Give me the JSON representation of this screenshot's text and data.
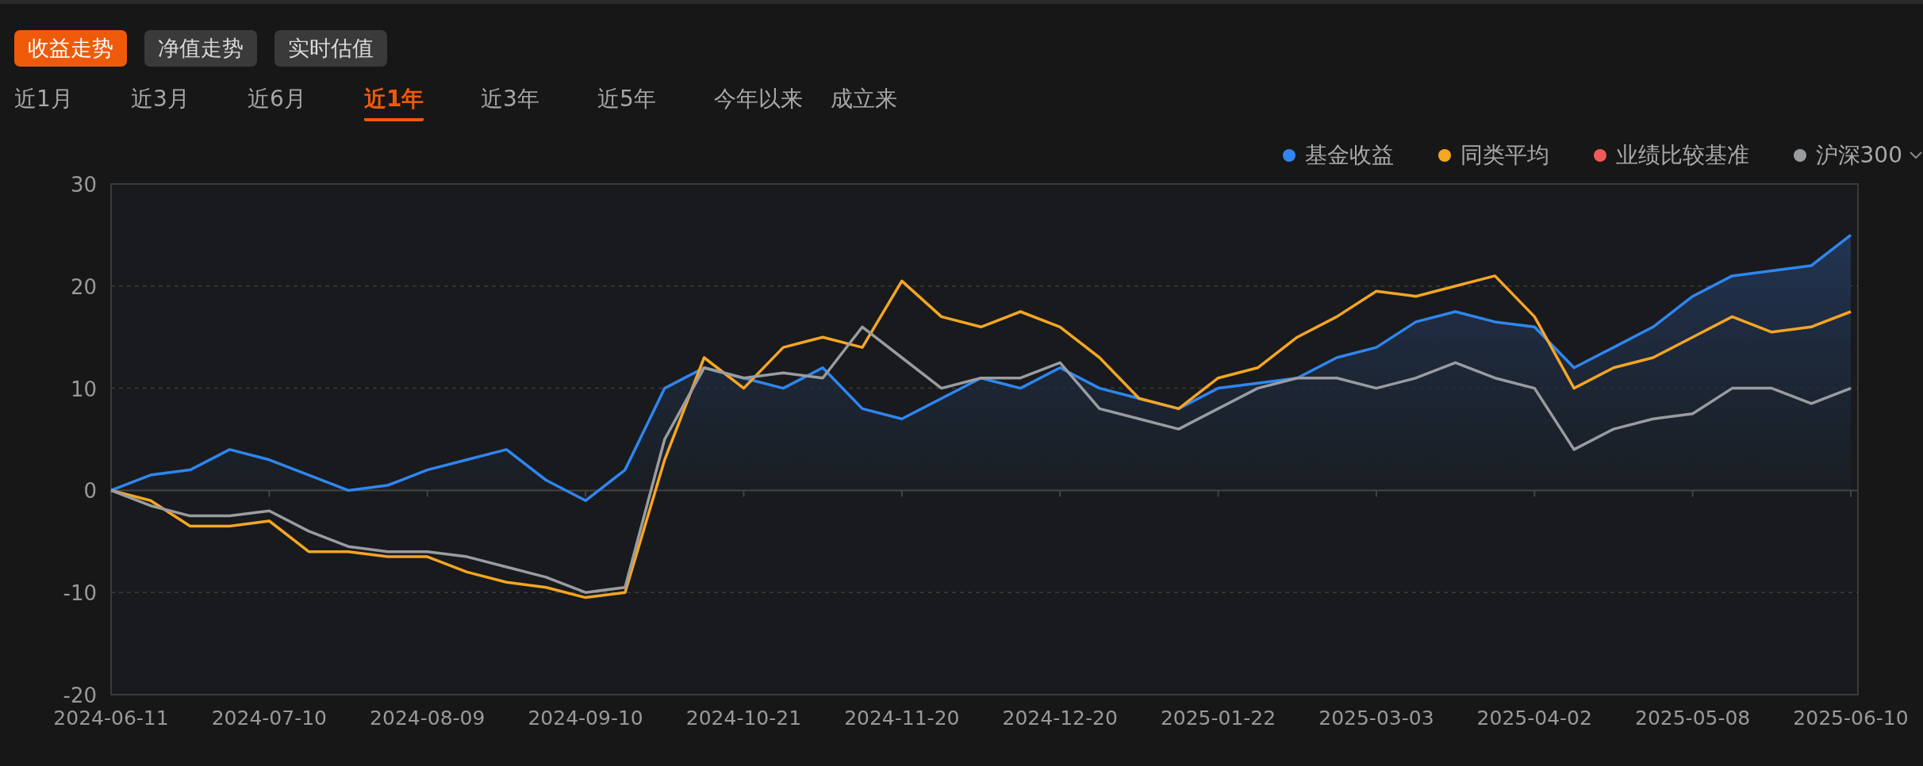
{
  "view_tabs": [
    {
      "label": "收益走势",
      "selected": true
    },
    {
      "label": "净值走势",
      "selected": false
    },
    {
      "label": "实时估值",
      "selected": false
    }
  ],
  "period_tabs": [
    {
      "label": "近1月",
      "selected": false
    },
    {
      "label": "近3月",
      "selected": false
    },
    {
      "label": "近6月",
      "selected": false
    },
    {
      "label": "近1年",
      "selected": true
    },
    {
      "label": "近3年",
      "selected": false
    },
    {
      "label": "近5年",
      "selected": false
    },
    {
      "label": "今年以来",
      "selected": false
    },
    {
      "label": "成立来",
      "selected": false
    }
  ],
  "chart_data": {
    "type": "line",
    "categories": [
      "2024-06-11",
      null,
      null,
      null,
      "2024-07-10",
      null,
      null,
      null,
      "2024-08-09",
      null,
      null,
      null,
      "2024-09-10",
      null,
      null,
      null,
      "2024-10-21",
      null,
      null,
      null,
      "2024-11-20",
      null,
      null,
      null,
      "2024-12-20",
      null,
      null,
      null,
      "2025-01-22",
      null,
      null,
      null,
      "2025-03-03",
      null,
      null,
      null,
      "2025-04-02",
      null,
      null,
      null,
      "2025-05-08",
      null,
      null,
      null,
      "2025-06-10"
    ],
    "yticks": [
      -20,
      -10,
      0,
      10,
      20,
      30
    ],
    "ylim": [
      -20,
      30
    ],
    "grid": true,
    "series": [
      {
        "name": "基金收益",
        "color": "#2f86f0",
        "type": "area",
        "values": [
          0,
          1.5,
          2,
          4,
          3,
          1.5,
          0,
          0.5,
          2,
          3,
          4,
          1,
          -1,
          2,
          10,
          12,
          11,
          10,
          12,
          8,
          7,
          9,
          11,
          10,
          12,
          10,
          9,
          8,
          10,
          10.5,
          11,
          13,
          14,
          16.5,
          17.5,
          16.5,
          16,
          12,
          14,
          16,
          19,
          21,
          21.5,
          22,
          25
        ]
      },
      {
        "name": "同类平均",
        "color": "#f5a623",
        "values": [
          0,
          -1,
          -3.5,
          -3.5,
          -3,
          -6,
          -6,
          -6.5,
          -6.5,
          -8,
          -9,
          -9.5,
          -10.5,
          -10,
          3,
          13,
          10,
          14,
          15,
          14,
          20.5,
          17,
          16,
          17.5,
          16,
          13,
          9,
          8,
          11,
          12,
          15,
          17,
          19.5,
          19,
          20,
          21,
          17,
          10,
          12,
          13,
          15,
          17,
          15.5,
          16,
          17.5
        ]
      },
      {
        "name": "业绩比较基准",
        "color": "#f25a5a",
        "values": [
          null,
          null,
          null,
          null,
          null,
          null,
          null,
          null,
          null,
          null,
          null,
          null,
          null,
          null,
          null,
          null,
          null,
          null,
          null,
          null,
          null,
          null,
          null,
          null,
          null,
          null,
          null,
          null,
          null,
          null,
          null,
          null,
          null,
          null,
          null,
          null,
          null,
          null,
          null,
          null,
          null,
          null,
          null,
          null,
          null
        ]
      },
      {
        "name": "沪深300",
        "color": "#9a9ca0",
        "values": [
          0,
          -1.5,
          -2.5,
          -2.5,
          -2,
          -4,
          -5.5,
          -6,
          -6,
          -6.5,
          -7.5,
          -8.5,
          -10,
          -9.5,
          5,
          12,
          11,
          11.5,
          11,
          16,
          13,
          10,
          11,
          11,
          12.5,
          8,
          7,
          6,
          8,
          10,
          11,
          11,
          10,
          11,
          12.5,
          11,
          10,
          4,
          6,
          7,
          7.5,
          10,
          10,
          8.5,
          10
        ]
      }
    ]
  }
}
